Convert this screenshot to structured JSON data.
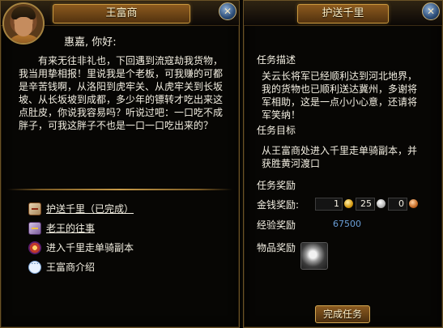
{
  "npc_dialog": {
    "title": "王富商",
    "close_label": "✕",
    "greeting": "惠嘉, 你好:",
    "text": "有来无往非礼也，下回遇到流寇劫我货物，我当用挚相报！里说我是个老板，可我赚的可都是辛苦钱啊，从洛阳到虎牢关、从虎牢关到长坂坡、从长坂坡到成都，多少年的镖转才吃出来这点肚皮，你说我容易吗？听说过吧：一口吃不成胖子，可我这胖子不也是一口一口吃出来的？",
    "options": [
      {
        "label": "护送千里（已完成）",
        "icon": "quest-scroll-icon"
      },
      {
        "label": "老王的往事",
        "icon": "quest-scroll-icon"
      },
      {
        "label": "进入千里走单骑副本",
        "icon": "teleport-icon"
      },
      {
        "label": "王富商介绍",
        "icon": "chat-bubble-icon"
      }
    ]
  },
  "quest_panel": {
    "title": "护送千里",
    "close_label": "✕",
    "description_label": "任务描述",
    "description": "关云长将军已经顺利达到河北地界，我的货物也已顺利送达冀州，多谢将军相助，这是一点小小心意，还请将军笑纳！",
    "objective_label": "任务目标",
    "objective": "从王富商处进入千里走单骑副本，并获胜黄河渡口",
    "rewards_label": "任务奖励",
    "money_label": "金钱奖励:",
    "money": {
      "gold": "1",
      "silver": "25",
      "copper": "0"
    },
    "exp_label": "经验奖励",
    "exp_value": "67500",
    "items_label": "物品奖励",
    "item_icon": "silver-ore-icon",
    "complete_button": "完成任务"
  },
  "colors": {
    "text": "#f3efe2",
    "accent_gold": "#c9983e",
    "exp_blue": "#6a9fd8",
    "panel_bg": "#070604"
  }
}
